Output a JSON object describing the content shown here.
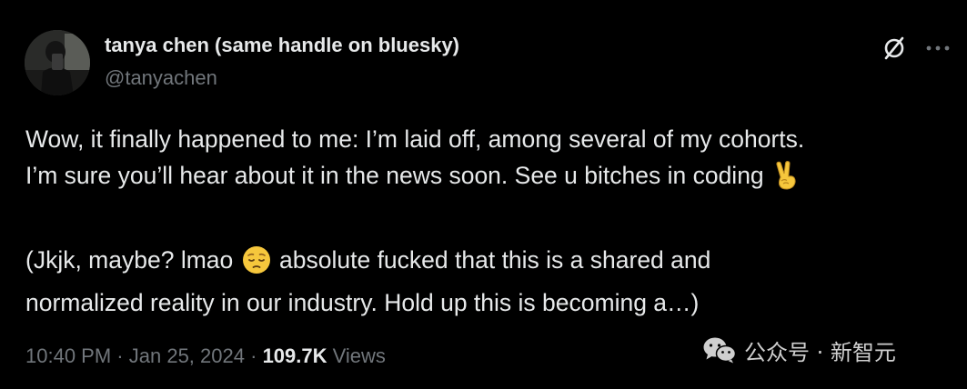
{
  "author": {
    "display_name": "tanya chen (same handle on bluesky)",
    "handle": "@tanyachen",
    "avatar_icon": "profile-photo"
  },
  "actions": {
    "grok_icon": "grok-icon",
    "more_icon": "more-options-icon"
  },
  "tweet": {
    "paragraph1_line1": "Wow, it finally happened to me: I’m laid off, among several of my cohorts.",
    "paragraph1_line2": "I’m sure you’ll hear about it in the news soon. See u bitches in coding",
    "paragraph1_emoji": "victory-hand-emoji",
    "paragraph2_line1_before": "(Jkjk, maybe? lmao",
    "paragraph2_emoji": "pensive-face-emoji",
    "paragraph2_line1_after": "absolute fucked that this is a shared and",
    "paragraph2_line2": "normalized reality in our industry. Hold up this is becoming a…)"
  },
  "meta": {
    "time": "10:40 PM",
    "separator": "·",
    "date": "Jan 25, 2024",
    "views_count": "109.7K",
    "views_label": "Views"
  },
  "watermark": {
    "icon": "wechat-icon",
    "text": "公众号 · 新智元"
  }
}
